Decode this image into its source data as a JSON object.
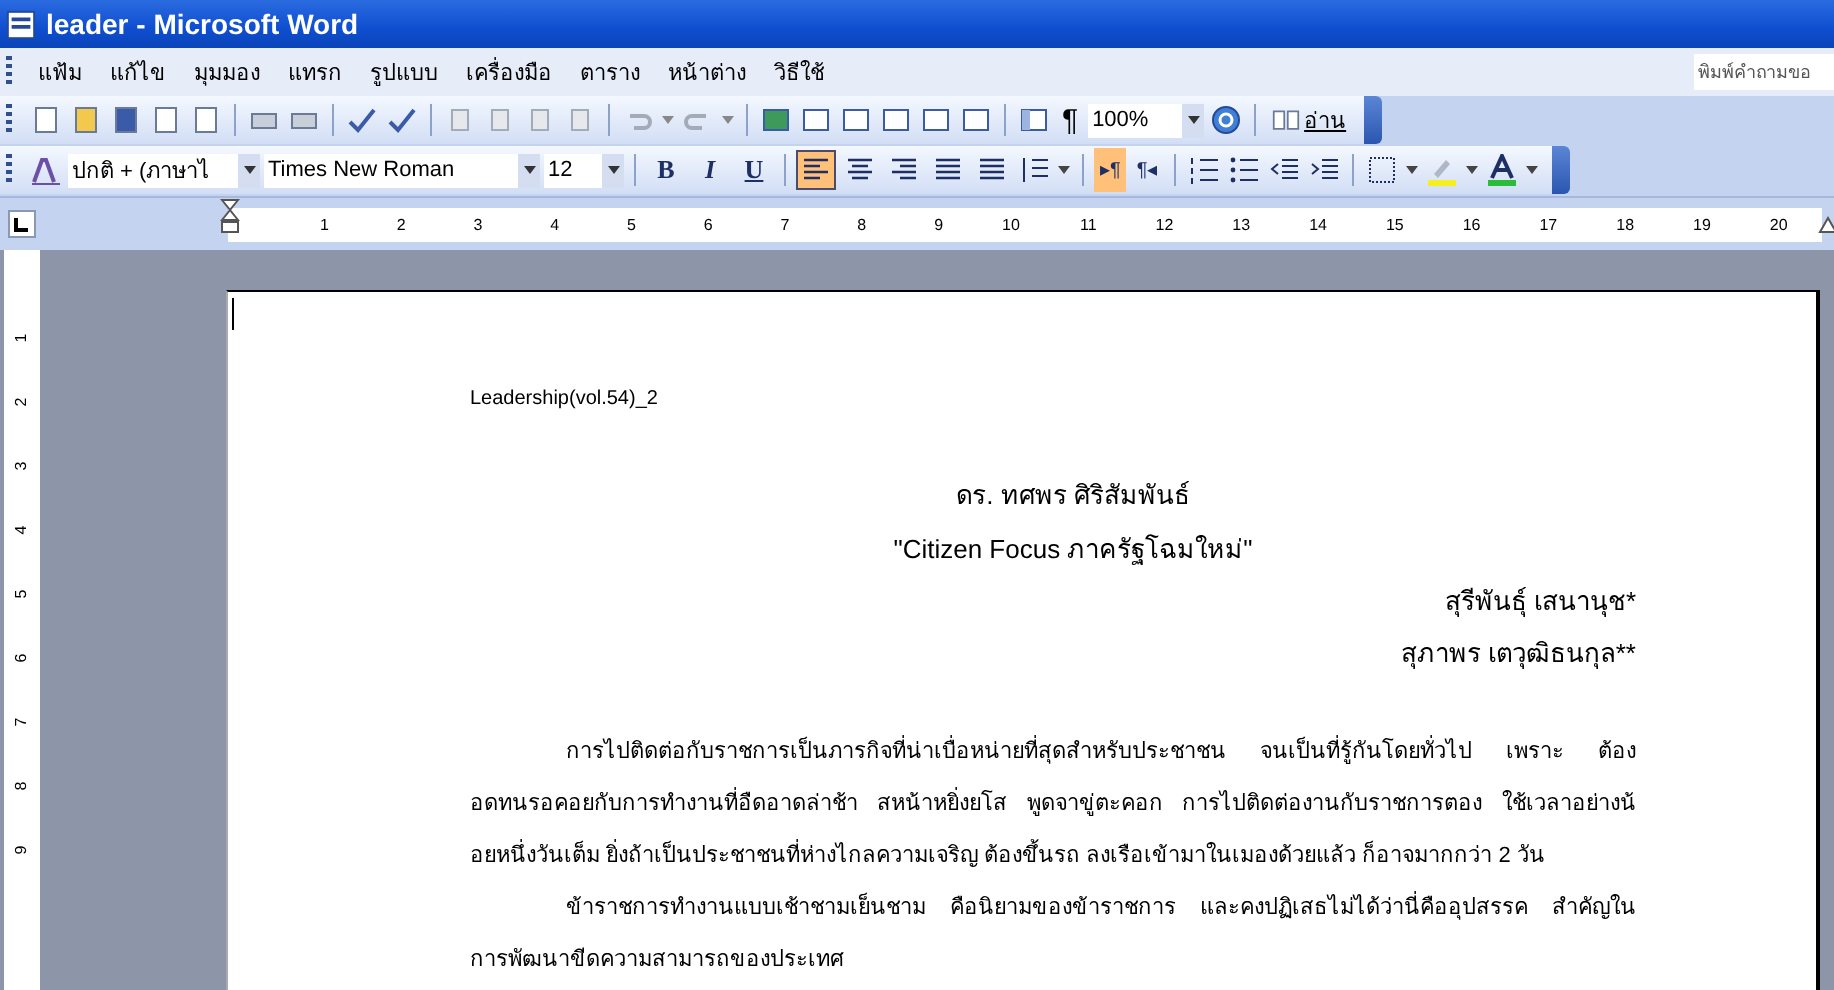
{
  "window": {
    "title": "leader - Microsoft Word"
  },
  "menu": [
    "แฟ้ม",
    "แก้ไข",
    "มุมมอง",
    "แทรก",
    "รูปแบบ",
    "เครื่องมือ",
    "ตาราง",
    "หน้าต่าง",
    "วิธีใช้"
  ],
  "help_box": {
    "placeholder": "พิมพ์คำถามขอ"
  },
  "standard_toolbar": {
    "pilcrow": "¶",
    "zoom": "100%",
    "read_button": "อ่าน"
  },
  "formatting_toolbar": {
    "style": "ปกติ + (ภาษาไ",
    "font": "Times New Roman",
    "size": "12",
    "bold": "B",
    "italic": "I",
    "underline": "U",
    "alignments": [
      {
        "selected": true
      },
      {
        "selected": false
      },
      {
        "selected": false
      },
      {
        "selected": false
      },
      {
        "selected": false
      }
    ],
    "directions": [
      {
        "label": "▸¶",
        "selected": true
      },
      {
        "label": "¶◂",
        "selected": false
      }
    ]
  },
  "ruler": [
    "1",
    "2",
    "3",
    "4",
    "5",
    "6",
    "7",
    "8",
    "9",
    "10",
    "11",
    "12",
    "13",
    "14",
    "15",
    "16",
    "17",
    "18",
    "19",
    "20"
  ],
  "vertical_ruler": [
    "1",
    "2",
    "3",
    "4",
    "5",
    "6",
    "7",
    "8",
    "9"
  ],
  "document": {
    "header": "Leadership(vol.54)_2",
    "title_lines": [
      "ดร. ทศพร ศิริสัมพันธ์",
      "\"Citizen Focus ภาครัฐโฉมใหม่\""
    ],
    "authors": [
      "สุรีพันธุ์ เสนานุช*",
      "สุภาพร เตวุฒิธนกุล**"
    ],
    "paragraphs": [
      {
        "lines": [
          "การไปติดต่อกับราชการเป็นภารกิจที่น่าเบื่อหน่ายที่สุดสำหรับประชาชน  จนเป็นที่รู้กันโดยทั่วไป  เพราะ  ต้อง",
          "อดทนรอคอยกับการทำงานที่อืดอาดล่าช้า สหน้าหยิ่งยโส พูดจาขู่ตะคอก การไปติดต่องานกับราชการตอง ใช้เวลาอย่างน้",
          "อยหนึ่งวันเต็ม ยิ่งถ้าเป็นประชาชนที่ห่างไกลความเจริญ ต้องขึ้นรถ ลงเรือเข้ามาในเมองด้วยแล้ว ก็อาจมากกว่า 2 วัน"
        ]
      },
      {
        "lines": [
          "ข้าราชการทำงานแบบเช้าชามเย็นชาม  คือนิยามของข้าราชการ  และคงปฏิเสธไม่ได้ว่านี่คืออุปสรรค  สำคัญใน",
          "การพัฒนาขีดความสามารถของประเทศ"
        ]
      }
    ]
  }
}
